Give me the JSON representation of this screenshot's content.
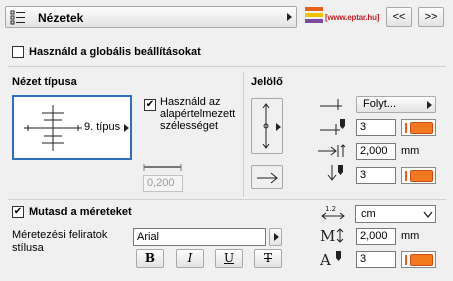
{
  "header": {
    "title": "Nézetek",
    "brand": "[www.eptar.hu]",
    "prev_label": "<<",
    "next_label": ">>",
    "accent": "#e8601a"
  },
  "global": {
    "label": "Használd a globális beállításokat",
    "checked": false
  },
  "view_type": {
    "heading": "Nézet típusa",
    "selected_type": "9. típus",
    "width_checkbox_label": "Használd az alapértelmezett szélességet",
    "width_checked": true,
    "width_value": "0,200"
  },
  "marker": {
    "heading": "Jelölő",
    "line_type": "Folyt...",
    "pen1": "3",
    "size_value": "2,000",
    "size_unit": "mm",
    "pen2": "3"
  },
  "dimensions": {
    "show_label": "Mutasd a méreteket",
    "show_checked": true,
    "unit_select": "cm",
    "font_label_line1": "Méretezési feliratok",
    "font_label_line2": "stílusa",
    "font_name": "Arial",
    "bold_label": "B",
    "italic_label": "I",
    "underline_label": "U",
    "strike_label": "T",
    "text_size": "2,000",
    "text_size_unit": "mm",
    "text_pen": "3",
    "pen_color": "#f4781e"
  }
}
